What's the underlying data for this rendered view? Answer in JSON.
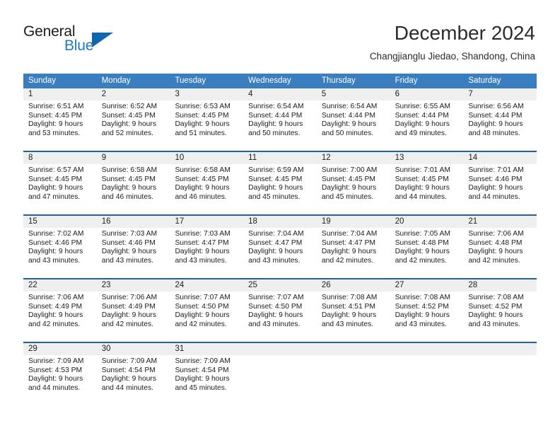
{
  "brand": {
    "name_part1": "General",
    "name_part2": "Blue",
    "accent_color": "#1f7ac4",
    "triangle_color": "#1266ab",
    "icon": "triangle-logo-icon"
  },
  "header": {
    "month_title": "December 2024",
    "location": "Changjianglu Jiedao, Shandong, China"
  },
  "calendar": {
    "header_bg_color": "#3a7ebf",
    "row_border_color": "#1d63a8",
    "daynum_bg_color": "#efefef",
    "weekday_names": [
      "Sunday",
      "Monday",
      "Tuesday",
      "Wednesday",
      "Thursday",
      "Friday",
      "Saturday"
    ],
    "weeks": [
      [
        {
          "day": "1",
          "sunrise": "Sunrise: 6:51 AM",
          "sunset": "Sunset: 4:45 PM",
          "daylight_line1": "Daylight: 9 hours",
          "daylight_line2": "and 53 minutes."
        },
        {
          "day": "2",
          "sunrise": "Sunrise: 6:52 AM",
          "sunset": "Sunset: 4:45 PM",
          "daylight_line1": "Daylight: 9 hours",
          "daylight_line2": "and 52 minutes."
        },
        {
          "day": "3",
          "sunrise": "Sunrise: 6:53 AM",
          "sunset": "Sunset: 4:45 PM",
          "daylight_line1": "Daylight: 9 hours",
          "daylight_line2": "and 51 minutes."
        },
        {
          "day": "4",
          "sunrise": "Sunrise: 6:54 AM",
          "sunset": "Sunset: 4:44 PM",
          "daylight_line1": "Daylight: 9 hours",
          "daylight_line2": "and 50 minutes."
        },
        {
          "day": "5",
          "sunrise": "Sunrise: 6:54 AM",
          "sunset": "Sunset: 4:44 PM",
          "daylight_line1": "Daylight: 9 hours",
          "daylight_line2": "and 50 minutes."
        },
        {
          "day": "6",
          "sunrise": "Sunrise: 6:55 AM",
          "sunset": "Sunset: 4:44 PM",
          "daylight_line1": "Daylight: 9 hours",
          "daylight_line2": "and 49 minutes."
        },
        {
          "day": "7",
          "sunrise": "Sunrise: 6:56 AM",
          "sunset": "Sunset: 4:44 PM",
          "daylight_line1": "Daylight: 9 hours",
          "daylight_line2": "and 48 minutes."
        }
      ],
      [
        {
          "day": "8",
          "sunrise": "Sunrise: 6:57 AM",
          "sunset": "Sunset: 4:45 PM",
          "daylight_line1": "Daylight: 9 hours",
          "daylight_line2": "and 47 minutes."
        },
        {
          "day": "9",
          "sunrise": "Sunrise: 6:58 AM",
          "sunset": "Sunset: 4:45 PM",
          "daylight_line1": "Daylight: 9 hours",
          "daylight_line2": "and 46 minutes."
        },
        {
          "day": "10",
          "sunrise": "Sunrise: 6:58 AM",
          "sunset": "Sunset: 4:45 PM",
          "daylight_line1": "Daylight: 9 hours",
          "daylight_line2": "and 46 minutes."
        },
        {
          "day": "11",
          "sunrise": "Sunrise: 6:59 AM",
          "sunset": "Sunset: 4:45 PM",
          "daylight_line1": "Daylight: 9 hours",
          "daylight_line2": "and 45 minutes."
        },
        {
          "day": "12",
          "sunrise": "Sunrise: 7:00 AM",
          "sunset": "Sunset: 4:45 PM",
          "daylight_line1": "Daylight: 9 hours",
          "daylight_line2": "and 45 minutes."
        },
        {
          "day": "13",
          "sunrise": "Sunrise: 7:01 AM",
          "sunset": "Sunset: 4:45 PM",
          "daylight_line1": "Daylight: 9 hours",
          "daylight_line2": "and 44 minutes."
        },
        {
          "day": "14",
          "sunrise": "Sunrise: 7:01 AM",
          "sunset": "Sunset: 4:46 PM",
          "daylight_line1": "Daylight: 9 hours",
          "daylight_line2": "and 44 minutes."
        }
      ],
      [
        {
          "day": "15",
          "sunrise": "Sunrise: 7:02 AM",
          "sunset": "Sunset: 4:46 PM",
          "daylight_line1": "Daylight: 9 hours",
          "daylight_line2": "and 43 minutes."
        },
        {
          "day": "16",
          "sunrise": "Sunrise: 7:03 AM",
          "sunset": "Sunset: 4:46 PM",
          "daylight_line1": "Daylight: 9 hours",
          "daylight_line2": "and 43 minutes."
        },
        {
          "day": "17",
          "sunrise": "Sunrise: 7:03 AM",
          "sunset": "Sunset: 4:47 PM",
          "daylight_line1": "Daylight: 9 hours",
          "daylight_line2": "and 43 minutes."
        },
        {
          "day": "18",
          "sunrise": "Sunrise: 7:04 AM",
          "sunset": "Sunset: 4:47 PM",
          "daylight_line1": "Daylight: 9 hours",
          "daylight_line2": "and 43 minutes."
        },
        {
          "day": "19",
          "sunrise": "Sunrise: 7:04 AM",
          "sunset": "Sunset: 4:47 PM",
          "daylight_line1": "Daylight: 9 hours",
          "daylight_line2": "and 42 minutes."
        },
        {
          "day": "20",
          "sunrise": "Sunrise: 7:05 AM",
          "sunset": "Sunset: 4:48 PM",
          "daylight_line1": "Daylight: 9 hours",
          "daylight_line2": "and 42 minutes."
        },
        {
          "day": "21",
          "sunrise": "Sunrise: 7:06 AM",
          "sunset": "Sunset: 4:48 PM",
          "daylight_line1": "Daylight: 9 hours",
          "daylight_line2": "and 42 minutes."
        }
      ],
      [
        {
          "day": "22",
          "sunrise": "Sunrise: 7:06 AM",
          "sunset": "Sunset: 4:49 PM",
          "daylight_line1": "Daylight: 9 hours",
          "daylight_line2": "and 42 minutes."
        },
        {
          "day": "23",
          "sunrise": "Sunrise: 7:06 AM",
          "sunset": "Sunset: 4:49 PM",
          "daylight_line1": "Daylight: 9 hours",
          "daylight_line2": "and 42 minutes."
        },
        {
          "day": "24",
          "sunrise": "Sunrise: 7:07 AM",
          "sunset": "Sunset: 4:50 PM",
          "daylight_line1": "Daylight: 9 hours",
          "daylight_line2": "and 42 minutes."
        },
        {
          "day": "25",
          "sunrise": "Sunrise: 7:07 AM",
          "sunset": "Sunset: 4:50 PM",
          "daylight_line1": "Daylight: 9 hours",
          "daylight_line2": "and 43 minutes."
        },
        {
          "day": "26",
          "sunrise": "Sunrise: 7:08 AM",
          "sunset": "Sunset: 4:51 PM",
          "daylight_line1": "Daylight: 9 hours",
          "daylight_line2": "and 43 minutes."
        },
        {
          "day": "27",
          "sunrise": "Sunrise: 7:08 AM",
          "sunset": "Sunset: 4:52 PM",
          "daylight_line1": "Daylight: 9 hours",
          "daylight_line2": "and 43 minutes."
        },
        {
          "day": "28",
          "sunrise": "Sunrise: 7:08 AM",
          "sunset": "Sunset: 4:52 PM",
          "daylight_line1": "Daylight: 9 hours",
          "daylight_line2": "and 43 minutes."
        }
      ],
      [
        {
          "day": "29",
          "sunrise": "Sunrise: 7:09 AM",
          "sunset": "Sunset: 4:53 PM",
          "daylight_line1": "Daylight: 9 hours",
          "daylight_line2": "and 44 minutes."
        },
        {
          "day": "30",
          "sunrise": "Sunrise: 7:09 AM",
          "sunset": "Sunset: 4:54 PM",
          "daylight_line1": "Daylight: 9 hours",
          "daylight_line2": "and 44 minutes."
        },
        {
          "day": "31",
          "sunrise": "Sunrise: 7:09 AM",
          "sunset": "Sunset: 4:54 PM",
          "daylight_line1": "Daylight: 9 hours",
          "daylight_line2": "and 45 minutes."
        },
        {
          "day": "",
          "sunrise": "",
          "sunset": "",
          "daylight_line1": "",
          "daylight_line2": ""
        },
        {
          "day": "",
          "sunrise": "",
          "sunset": "",
          "daylight_line1": "",
          "daylight_line2": ""
        },
        {
          "day": "",
          "sunrise": "",
          "sunset": "",
          "daylight_line1": "",
          "daylight_line2": ""
        },
        {
          "day": "",
          "sunrise": "",
          "sunset": "",
          "daylight_line1": "",
          "daylight_line2": ""
        }
      ]
    ]
  }
}
